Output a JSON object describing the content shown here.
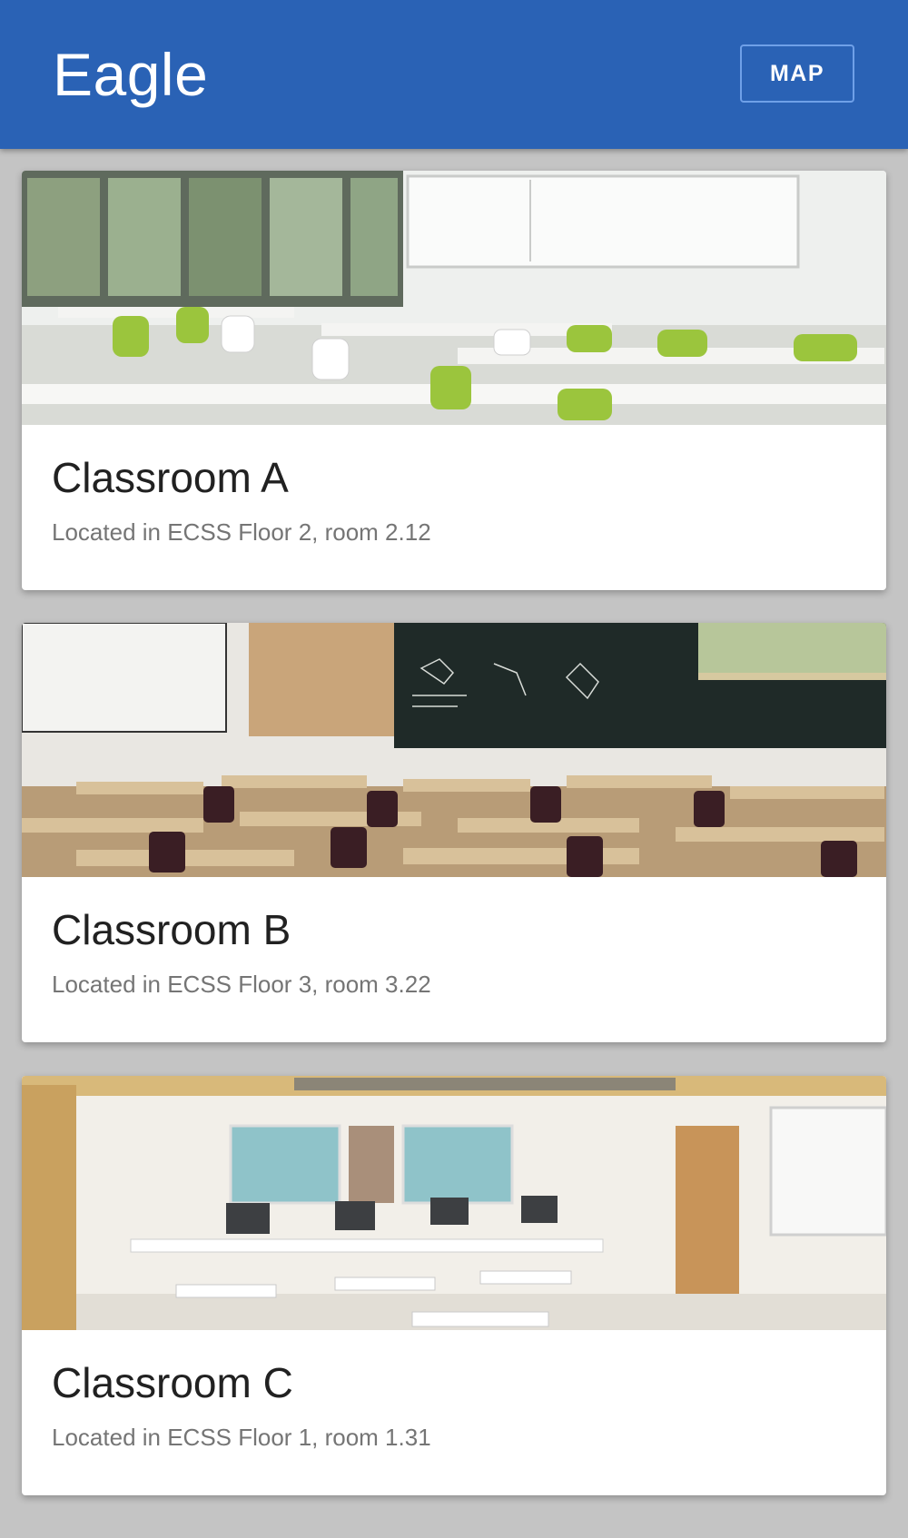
{
  "app_bar": {
    "title": "Eagle",
    "map_button_label": "MAP",
    "color": "#2a62b5"
  },
  "cards": [
    {
      "title": "Classroom A",
      "subtitle": "Located in ECSS Floor 2, room 2.12",
      "image": "classroom-with-green-chairs"
    },
    {
      "title": "Classroom B",
      "subtitle": "Located in ECSS Floor 3, room 3.22",
      "image": "classroom-with-desks-and-chalkboard"
    },
    {
      "title": "Classroom C",
      "subtitle": "Located in ECSS Floor 1, room 1.31",
      "image": "computer-lab-classroom"
    }
  ]
}
